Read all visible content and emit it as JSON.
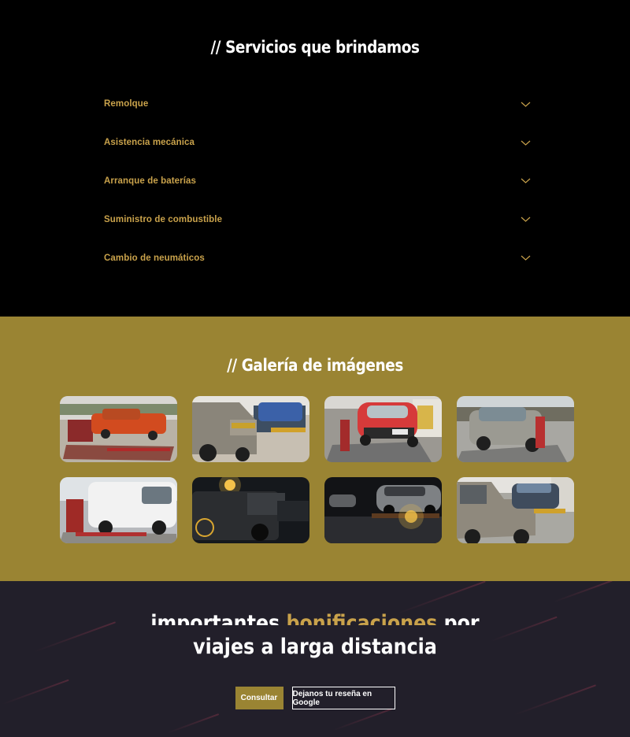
{
  "services": {
    "title_prefix": "//",
    "title": "Servicios que brindamos",
    "items": [
      {
        "label": "Remolque"
      },
      {
        "label": "Asistencia mecánica"
      },
      {
        "label": "Arranque de baterías"
      },
      {
        "label": "Suministro de combustible"
      },
      {
        "label": "Cambio de neumáticos"
      }
    ],
    "chevron_icon": "chevron-down-icon"
  },
  "gallery": {
    "title_prefix": "//",
    "title": "Galería de imágenes",
    "images": [
      {
        "alt": "grua-remolque-auto-rojo"
      },
      {
        "alt": "camioneta-remolque-auto-azul"
      },
      {
        "alt": "grua-auto-rojo-calle"
      },
      {
        "alt": "grua-auto-gris"
      },
      {
        "alt": "grua-furgon-blanco"
      },
      {
        "alt": "grua-nocturna-camioneta"
      },
      {
        "alt": "grua-nocturna-auto-gris"
      },
      {
        "alt": "camioneta-remolque-auto-azul-2"
      }
    ]
  },
  "cta": {
    "line1_a": "importantes ",
    "line1_highlight": "bonificaciones",
    "line1_b": " por",
    "line2": "viajes a larga distancia",
    "btn_primary": "Consultar",
    "btn_secondary": "Dejanos tu reseña en Google"
  },
  "colors": {
    "accent": "#c9a24b",
    "gold_bg": "#9a8433",
    "dark_bg": "#221f2a"
  }
}
